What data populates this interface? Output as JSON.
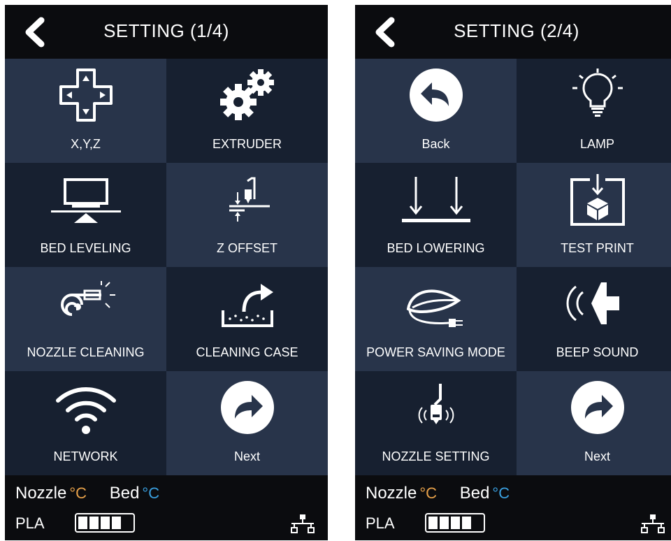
{
  "screens": [
    {
      "title": "SETTING (1/4)",
      "tiles": [
        {
          "label": "X,Y,Z",
          "icon": "dpad-icon"
        },
        {
          "label": "EXTRUDER",
          "icon": "gears-icon"
        },
        {
          "label": "BED LEVELING",
          "icon": "bed-leveling-icon"
        },
        {
          "label": "Z OFFSET",
          "icon": "z-offset-icon"
        },
        {
          "label": "NOZZLE CLEANING",
          "icon": "nozzle-cleaning-icon"
        },
        {
          "label": "CLEANING CASE",
          "icon": "cleaning-case-icon"
        },
        {
          "label": "NETWORK",
          "icon": "wifi-icon"
        },
        {
          "label": "Next",
          "icon": "next-arrow-icon"
        }
      ],
      "status": {
        "nozzle": "Nozzle",
        "bed": "Bed",
        "deg": "°C",
        "material": "PLA"
      }
    },
    {
      "title": "SETTING (2/4)",
      "tiles": [
        {
          "label": "Back",
          "icon": "back-arrow-icon"
        },
        {
          "label": "LAMP",
          "icon": "lamp-icon"
        },
        {
          "label": "BED LOWERING",
          "icon": "bed-lowering-icon"
        },
        {
          "label": "TEST PRINT",
          "icon": "test-print-icon"
        },
        {
          "label": "POWER SAVING MODE",
          "icon": "power-saving-icon"
        },
        {
          "label": "BEEP SOUND",
          "icon": "speaker-icon"
        },
        {
          "label": "NOZZLE SETTING",
          "icon": "nozzle-setting-icon"
        },
        {
          "label": "Next",
          "icon": "next-arrow-icon"
        }
      ],
      "status": {
        "nozzle": "Nozzle",
        "bed": "Bed",
        "deg": "°C",
        "material": "PLA"
      }
    }
  ],
  "colors": {
    "tile_light": "#28344a",
    "tile_dark": "#172030",
    "nozzle_accent": "#e8a24a",
    "bed_accent": "#3aa0e0"
  }
}
